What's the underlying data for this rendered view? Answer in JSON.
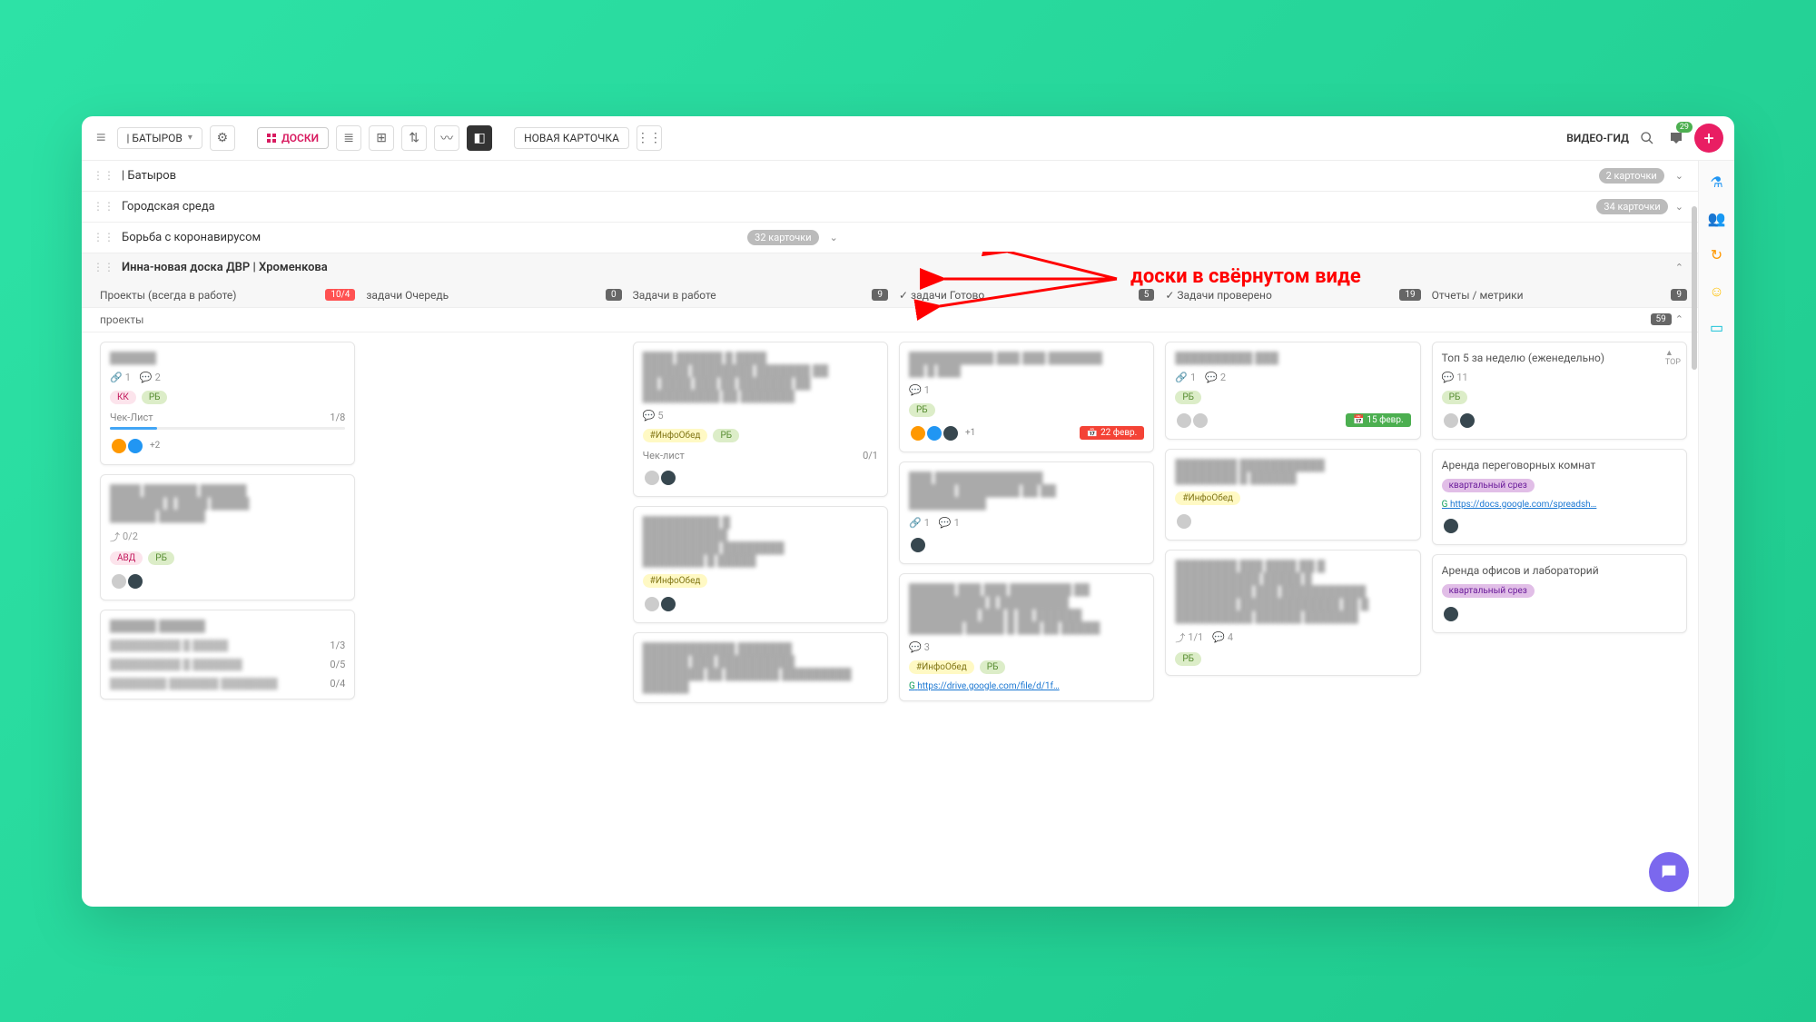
{
  "toolbar": {
    "workspace": "| БАТЫРОВ",
    "boards_label": "ДОСКИ",
    "new_card": "НОВАЯ КАРТОЧКА",
    "video_guide": "ВИДЕО-ГИД",
    "notif_count": "29"
  },
  "annotation": "доски в свёрнутом виде",
  "collapsed_boards": [
    {
      "name": "| Батыров",
      "count": "2 карточки"
    },
    {
      "name": "Городская среда",
      "count": "34 карточки"
    },
    {
      "name": "Борьба с коронавирусом",
      "count": "32 карточки"
    }
  ],
  "expanded_board": {
    "name": "Инна-новая доска ДВР | Хроменкова",
    "columns": [
      {
        "label": "Проекты (всегда в работе)",
        "badge": "10/4",
        "badge_class": "red"
      },
      {
        "label": "задачи Очередь",
        "badge": "0"
      },
      {
        "label": "Задачи в работе",
        "badge": "9"
      },
      {
        "label": "задачи Готово",
        "badge": "5",
        "check": true
      },
      {
        "label": "Задачи проверено",
        "badge": "19",
        "check": true
      },
      {
        "label": "Отчеты / метрики",
        "badge": "9"
      }
    ],
    "swimlane": {
      "name": "проекты",
      "count": "59"
    }
  },
  "cards": {
    "col0": [
      {
        "attach": "1",
        "comments": "2",
        "tags": [
          {
            "t": "КК",
            "c": "pink"
          },
          {
            "t": "РБ",
            "c": "green"
          }
        ],
        "check_label": "Чек-Лист",
        "check_count": "1/8",
        "avatars": [
          "orange",
          "blue"
        ],
        "av_more": "+2"
      },
      {
        "subtasks": "0/2",
        "tags": [
          {
            "t": "АВД",
            "c": "pink"
          },
          {
            "t": "РБ",
            "c": "green"
          }
        ],
        "avatars": [
          "grey",
          "dark"
        ]
      },
      {
        "checks": [
          "1/3",
          "0/5",
          "0/4"
        ]
      }
    ],
    "col2": [
      {
        "comments": "5",
        "tags": [
          {
            "t": "#ИнфоОбед",
            "c": "yellow"
          },
          {
            "t": "РБ",
            "c": "green"
          }
        ],
        "check_label": "Чек-лист",
        "check_count": "0/1",
        "avatars": [
          "grey",
          "dark"
        ]
      },
      {
        "tags": [
          {
            "t": "#ИнфоОбед",
            "c": "yellow"
          }
        ],
        "avatars": [
          "grey",
          "dark"
        ]
      },
      {
        "blur_lines": 4
      }
    ],
    "col3": [
      {
        "comments": "1",
        "tags": [
          {
            "t": "РБ",
            "c": "green"
          }
        ],
        "avatars": [
          "orange",
          "blue",
          "dark"
        ],
        "av_more": "+1",
        "date": "22 февр.",
        "date_class": "red"
      },
      {
        "attach": "1",
        "comments": "1",
        "avatars": [
          "dark"
        ]
      },
      {
        "comments": "3",
        "tags": [
          {
            "t": "#ИнфоОбед",
            "c": "yellow"
          },
          {
            "t": "РБ",
            "c": "green"
          }
        ],
        "link": "https://drive.google.com/file/d/1f…"
      }
    ],
    "col4": [
      {
        "attach": "1",
        "comments": "2",
        "tags": [
          {
            "t": "РБ",
            "c": "green"
          }
        ],
        "avatars": [
          "grey",
          "grey"
        ],
        "date": "15 февр.",
        "date_class": "green"
      },
      {
        "tags": [
          {
            "t": "#ИнфоОбед",
            "c": "yellow"
          }
        ],
        "avatars": [
          "grey"
        ]
      },
      {
        "subtasks": "1/1",
        "comments": "4",
        "tags": [
          {
            "t": "РБ",
            "c": "green"
          }
        ]
      }
    ],
    "col5": [
      {
        "title": "Топ 5 за неделю (еженедельно)",
        "comments": "11",
        "tags": [
          {
            "t": "РБ",
            "c": "green"
          }
        ],
        "avatars": [
          "grey",
          "dark"
        ],
        "top_marker": "TOP"
      },
      {
        "title": "Аренда переговорных комнат",
        "tags": [
          {
            "t": "квартальный срез",
            "c": "purple"
          }
        ],
        "link": "https://docs.google.com/spreadsh…",
        "avatars": [
          "dark"
        ]
      },
      {
        "title": "Аренда офисов и лабораторий",
        "tags": [
          {
            "t": "квартальный срез",
            "c": "purple"
          }
        ],
        "avatars": [
          "dark"
        ]
      }
    ]
  }
}
